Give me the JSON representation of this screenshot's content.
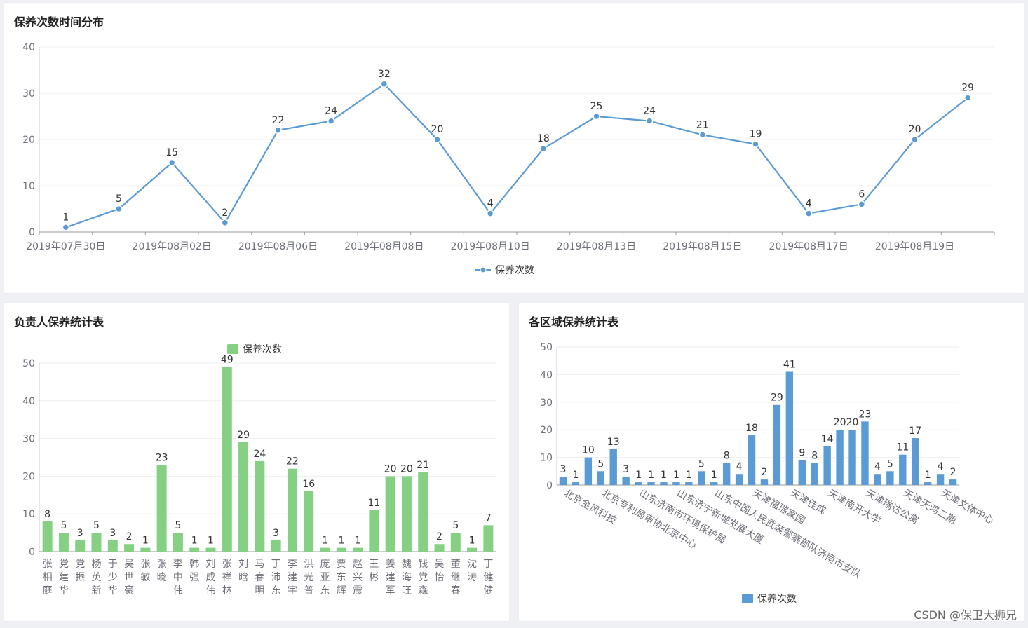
{
  "watermark": "CSDN @保卫大狮兄",
  "panels": {
    "time": {
      "title": "保养次数时间分布"
    },
    "person": {
      "title": "负责人保养统计表"
    },
    "region": {
      "title": "各区域保养统计表"
    }
  },
  "chart_data": [
    {
      "type": "line",
      "title": "保养次数时间分布",
      "legend": "保养次数",
      "color": "#5b9bd5",
      "ylim": [
        0,
        40
      ],
      "yticks": [
        0,
        10,
        20,
        30,
        40
      ],
      "xtick_labels": [
        "2019年07月30日",
        "2019年08月02日",
        "2019年08月06日",
        "2019年08月08日",
        "2019年08月10日",
        "2019年08月13日",
        "2019年08月15日",
        "2019年08月17日",
        "2019年08月19日"
      ],
      "values": [
        1,
        5,
        15,
        2,
        22,
        24,
        32,
        20,
        4,
        18,
        25,
        24,
        21,
        19,
        4,
        6,
        20,
        29
      ],
      "grid": true,
      "legend_position": "bottom"
    },
    {
      "type": "bar",
      "title": "负责人保养统计表",
      "legend": "保养次数",
      "color": "#85d083",
      "ylim": [
        0,
        50
      ],
      "yticks": [
        0,
        10,
        20,
        30,
        40,
        50
      ],
      "categories": [
        "张相庭",
        "党建华",
        "党振",
        "杨英新",
        "于少华",
        "吴世豪",
        "张敏",
        "张晓",
        "李中伟",
        "韩强",
        "刘成伟",
        "张祥林",
        "刘晗",
        "马春明",
        "丁沛东",
        "李建宇",
        "洪光普",
        "庞亚东",
        "贾东辉",
        "赵兴震",
        "王彬",
        "姜建军",
        "魏海旺",
        "钱党森",
        "吴怡",
        "董继春",
        "沈涛",
        "丁健健"
      ],
      "values": [
        8,
        5,
        3,
        5,
        3,
        2,
        1,
        23,
        5,
        1,
        1,
        49,
        29,
        24,
        3,
        22,
        16,
        1,
        1,
        1,
        11,
        20,
        20,
        21,
        2,
        5,
        1,
        7
      ],
      "grid": true,
      "legend_position": "top"
    },
    {
      "type": "bar",
      "title": "各区域保养统计表",
      "legend": "保养次数",
      "color": "#5b9bd5",
      "ylim": [
        0,
        50
      ],
      "yticks": [
        0,
        10,
        20,
        30,
        40,
        50
      ],
      "values": [
        3,
        1,
        10,
        5,
        13,
        3,
        1,
        1,
        1,
        1,
        1,
        5,
        1,
        8,
        4,
        18,
        2,
        29,
        41,
        9,
        8,
        14,
        20,
        20,
        23,
        4,
        5,
        11,
        17,
        1,
        4,
        2
      ],
      "visible_category_labels": [
        "北京金风科技",
        "北京专利局审协北京中心",
        "山东济南市环境保护局",
        "山东济宁新城发展大厦",
        "山东中国人民武装警察部队济南市支队",
        "天津福瑞家园",
        "天津佳成",
        "天津南开大学",
        "天津瑞达公寓",
        "天津天鸿二期",
        "天津文体中心"
      ],
      "grid": true,
      "legend_position": "bottom"
    }
  ]
}
